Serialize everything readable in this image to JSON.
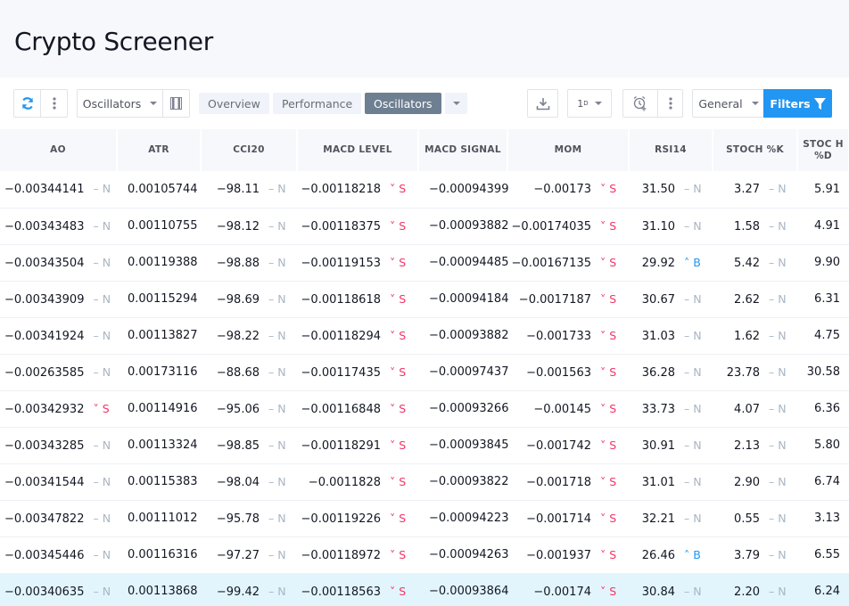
{
  "header": {
    "title": "Crypto Screener"
  },
  "toolbar": {
    "refresh_icon": "refresh-icon",
    "more_icon": "more-vertical-icon",
    "columns_set": "Oscillators",
    "columns_icon": "columns-icon",
    "tabs": [
      {
        "label": "Overview",
        "active": false
      },
      {
        "label": "Performance",
        "active": false
      },
      {
        "label": "Oscillators",
        "active": true
      }
    ],
    "tabs_more_icon": "chevron-down-icon",
    "export_icon": "download-icon",
    "interval": "1",
    "interval_sup": "D",
    "alert_icon": "alarm-clock-add-icon",
    "alert_more_icon": "more-vertical-icon",
    "filter_set": "General",
    "filters_label": "Filters",
    "filters_icon": "funnel-icon"
  },
  "colors": {
    "accent": "#2196f3",
    "sell": "#f23567",
    "buy": "#2196f3",
    "neutral": "#a8b6c3",
    "active_tab": "#6e7f91"
  },
  "table": {
    "columns": [
      "AO",
      "ATR",
      "CCI20",
      "MACD LEVEL",
      "MACD SIGNAL",
      "MOM",
      "RSI14",
      "STOCH %K",
      "STOC H %D"
    ],
    "rows": [
      {
        "ao": "−0.00344141",
        "ao_r": "N",
        "atr": "0.00105744",
        "cci": "−98.11",
        "cci_r": "N",
        "macd": "−0.00118218",
        "macd_r": "S",
        "signal": "−0.00094399",
        "mom": "−0.00173",
        "mom_r": "S",
        "rsi": "31.50",
        "rsi_r": "N",
        "k": "3.27",
        "k_r": "N",
        "d": "5.91"
      },
      {
        "ao": "−0.00343483",
        "ao_r": "N",
        "atr": "0.00110755",
        "cci": "−98.12",
        "cci_r": "N",
        "macd": "−0.00118375",
        "macd_r": "S",
        "signal": "−0.00093882",
        "mom": "−0.00174035",
        "mom_r": "S",
        "rsi": "31.10",
        "rsi_r": "N",
        "k": "1.58",
        "k_r": "N",
        "d": "4.91"
      },
      {
        "ao": "−0.00343504",
        "ao_r": "N",
        "atr": "0.00119388",
        "cci": "−98.88",
        "cci_r": "N",
        "macd": "−0.00119153",
        "macd_r": "S",
        "signal": "−0.00094485",
        "mom": "−0.00167135",
        "mom_r": "S",
        "rsi": "29.92",
        "rsi_r": "B",
        "k": "5.42",
        "k_r": "N",
        "d": "9.90"
      },
      {
        "ao": "−0.00343909",
        "ao_r": "N",
        "atr": "0.00115294",
        "cci": "−98.69",
        "cci_r": "N",
        "macd": "−0.00118618",
        "macd_r": "S",
        "signal": "−0.00094184",
        "mom": "−0.0017187",
        "mom_r": "S",
        "rsi": "30.67",
        "rsi_r": "N",
        "k": "2.62",
        "k_r": "N",
        "d": "6.31"
      },
      {
        "ao": "−0.00341924",
        "ao_r": "N",
        "atr": "0.00113827",
        "cci": "−98.22",
        "cci_r": "N",
        "macd": "−0.00118294",
        "macd_r": "S",
        "signal": "−0.00093882",
        "mom": "−0.001733",
        "mom_r": "S",
        "rsi": "31.03",
        "rsi_r": "N",
        "k": "1.62",
        "k_r": "N",
        "d": "4.75"
      },
      {
        "ao": "−0.00263585",
        "ao_r": "N",
        "atr": "0.00173116",
        "cci": "−88.68",
        "cci_r": "N",
        "macd": "−0.00117435",
        "macd_r": "S",
        "signal": "−0.00097437",
        "mom": "−0.001563",
        "mom_r": "S",
        "rsi": "36.28",
        "rsi_r": "N",
        "k": "23.78",
        "k_r": "N",
        "d": "30.58"
      },
      {
        "ao": "−0.00342932",
        "ao_r": "S",
        "atr": "0.00114916",
        "cci": "−95.06",
        "cci_r": "N",
        "macd": "−0.00116848",
        "macd_r": "S",
        "signal": "−0.00093266",
        "mom": "−0.00145",
        "mom_r": "S",
        "rsi": "33.73",
        "rsi_r": "N",
        "k": "4.07",
        "k_r": "N",
        "d": "6.36"
      },
      {
        "ao": "−0.00343285",
        "ao_r": "N",
        "atr": "0.00113324",
        "cci": "−98.85",
        "cci_r": "N",
        "macd": "−0.00118291",
        "macd_r": "S",
        "signal": "−0.00093845",
        "mom": "−0.001742",
        "mom_r": "S",
        "rsi": "30.91",
        "rsi_r": "N",
        "k": "2.13",
        "k_r": "N",
        "d": "5.80"
      },
      {
        "ao": "−0.00341544",
        "ao_r": "N",
        "atr": "0.00115383",
        "cci": "−98.04",
        "cci_r": "N",
        "macd": "−0.0011828",
        "macd_r": "S",
        "signal": "−0.00093822",
        "mom": "−0.001718",
        "mom_r": "S",
        "rsi": "31.01",
        "rsi_r": "N",
        "k": "2.90",
        "k_r": "N",
        "d": "6.74"
      },
      {
        "ao": "−0.00347822",
        "ao_r": "N",
        "atr": "0.00111012",
        "cci": "−95.78",
        "cci_r": "N",
        "macd": "−0.00119226",
        "macd_r": "S",
        "signal": "−0.00094223",
        "mom": "−0.001714",
        "mom_r": "S",
        "rsi": "32.21",
        "rsi_r": "N",
        "k": "0.55",
        "k_r": "N",
        "d": "3.13"
      },
      {
        "ao": "−0.00345446",
        "ao_r": "N",
        "atr": "0.00116316",
        "cci": "−97.27",
        "cci_r": "N",
        "macd": "−0.00118972",
        "macd_r": "S",
        "signal": "−0.00094263",
        "mom": "−0.001937",
        "mom_r": "S",
        "rsi": "26.46",
        "rsi_r": "B",
        "k": "3.79",
        "k_r": "N",
        "d": "6.55"
      },
      {
        "ao": "−0.00340635",
        "ao_r": "N",
        "atr": "0.00113868",
        "cci": "−99.42",
        "cci_r": "N",
        "macd": "−0.00118563",
        "macd_r": "S",
        "signal": "−0.00093864",
        "mom": "−0.00174",
        "mom_r": "S",
        "rsi": "30.84",
        "rsi_r": "N",
        "k": "2.20",
        "k_r": "N",
        "d": "6.24",
        "selected": true
      }
    ]
  }
}
